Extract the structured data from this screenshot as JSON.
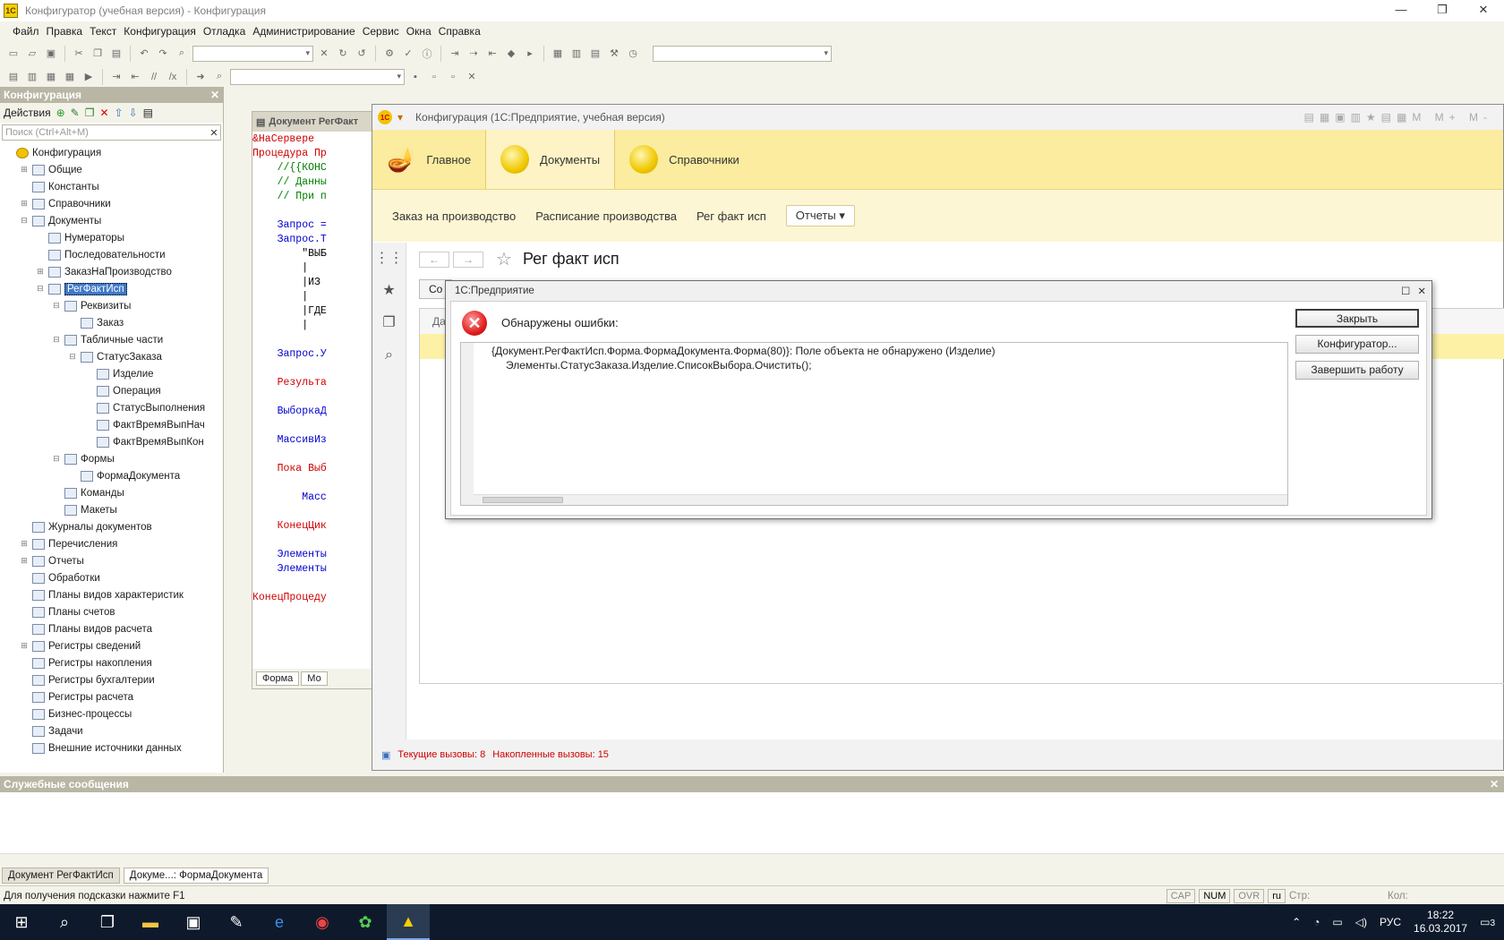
{
  "window": {
    "title": "Конфигуратор (учебная версия) - Конфигурация",
    "controls": [
      "—",
      "❐",
      "✕"
    ]
  },
  "menu": [
    "Файл",
    "Правка",
    "Текст",
    "Конфигурация",
    "Отладка",
    "Администрирование",
    "Сервис",
    "Окна",
    "Справка"
  ],
  "config_panel": {
    "title": "Конфигурация",
    "actions_label": "Действия",
    "search_placeholder": "Поиск (Ctrl+Alt+M)",
    "tree": [
      {
        "label": "Конфигурация",
        "level": 0,
        "exp": "",
        "icon": "config-icon"
      },
      {
        "label": "Общие",
        "level": 1,
        "exp": "⊞",
        "icon": "common-icon"
      },
      {
        "label": "Константы",
        "level": 1,
        "exp": "",
        "icon": "constants-icon"
      },
      {
        "label": "Справочники",
        "level": 1,
        "exp": "⊞",
        "icon": "catalogs-icon"
      },
      {
        "label": "Документы",
        "level": 1,
        "exp": "⊟",
        "icon": "documents-icon"
      },
      {
        "label": "Нумераторы",
        "level": 2,
        "exp": "",
        "icon": "numerators-icon"
      },
      {
        "label": "Последовательности",
        "level": 2,
        "exp": "",
        "icon": "sequences-icon"
      },
      {
        "label": "ЗаказНаПроизводство",
        "level": 2,
        "exp": "⊞",
        "icon": "document-icon"
      },
      {
        "label": "РегФактИсп",
        "level": 2,
        "exp": "⊟",
        "icon": "document-icon",
        "selected": true
      },
      {
        "label": "Реквизиты",
        "level": 3,
        "exp": "⊟",
        "icon": "attributes-icon"
      },
      {
        "label": "Заказ",
        "level": 4,
        "exp": "",
        "icon": "attribute-icon"
      },
      {
        "label": "Табличные части",
        "level": 3,
        "exp": "⊟",
        "icon": "tabular-icon"
      },
      {
        "label": "СтатусЗаказа",
        "level": 4,
        "exp": "⊟",
        "icon": "tabular-icon"
      },
      {
        "label": "Изделие",
        "level": 5,
        "exp": "",
        "icon": "attribute-icon"
      },
      {
        "label": "Операция",
        "level": 5,
        "exp": "",
        "icon": "attribute-icon"
      },
      {
        "label": "СтатусВыполнения",
        "level": 5,
        "exp": "",
        "icon": "attribute-icon"
      },
      {
        "label": "ФактВремяВыпНач",
        "level": 5,
        "exp": "",
        "icon": "attribute-icon"
      },
      {
        "label": "ФактВремяВыпКон",
        "level": 5,
        "exp": "",
        "icon": "attribute-icon"
      },
      {
        "label": "Формы",
        "level": 3,
        "exp": "⊟",
        "icon": "forms-icon"
      },
      {
        "label": "ФормаДокумента",
        "level": 4,
        "exp": "",
        "icon": "form-icon"
      },
      {
        "label": "Команды",
        "level": 3,
        "exp": "",
        "icon": "commands-icon"
      },
      {
        "label": "Макеты",
        "level": 3,
        "exp": "",
        "icon": "templates-icon"
      },
      {
        "label": "Журналы документов",
        "level": 1,
        "exp": "",
        "icon": "journals-icon"
      },
      {
        "label": "Перечисления",
        "level": 1,
        "exp": "⊞",
        "icon": "enums-icon"
      },
      {
        "label": "Отчеты",
        "level": 1,
        "exp": "⊞",
        "icon": "reports-icon"
      },
      {
        "label": "Обработки",
        "level": 1,
        "exp": "",
        "icon": "processing-icon"
      },
      {
        "label": "Планы видов характеристик",
        "level": 1,
        "exp": "",
        "icon": "chart-char-icon"
      },
      {
        "label": "Планы счетов",
        "level": 1,
        "exp": "",
        "icon": "chart-acc-icon"
      },
      {
        "label": "Планы видов расчета",
        "level": 1,
        "exp": "",
        "icon": "chart-calc-icon"
      },
      {
        "label": "Регистры сведений",
        "level": 1,
        "exp": "⊞",
        "icon": "info-reg-icon"
      },
      {
        "label": "Регистры накопления",
        "level": 1,
        "exp": "",
        "icon": "accum-reg-icon"
      },
      {
        "label": "Регистры бухгалтерии",
        "level": 1,
        "exp": "",
        "icon": "acc-reg-icon"
      },
      {
        "label": "Регистры расчета",
        "level": 1,
        "exp": "",
        "icon": "calc-reg-icon"
      },
      {
        "label": "Бизнес-процессы",
        "level": 1,
        "exp": "",
        "icon": "bp-icon"
      },
      {
        "label": "Задачи",
        "level": 1,
        "exp": "",
        "icon": "tasks-icon"
      },
      {
        "label": "Внешние источники данных",
        "level": 1,
        "exp": "",
        "icon": "ext-src-icon"
      }
    ]
  },
  "code_window": {
    "title": "Документ РегФакт",
    "lines": [
      {
        "t": "&НаСервере",
        "c": "cr"
      },
      {
        "t": "Процедура Пр",
        "c": "cr"
      },
      {
        "t": "    //{{КОНС",
        "c": "cg"
      },
      {
        "t": "    // Данны",
        "c": "cg"
      },
      {
        "t": "    // При п",
        "c": "cg"
      },
      {
        "t": "",
        "c": "ck"
      },
      {
        "t": "    Запрос =",
        "c": "cb"
      },
      {
        "t": "    Запрос.Т",
        "c": "cb"
      },
      {
        "t": "        \"ВЫБ",
        "c": "ck"
      },
      {
        "t": "        |",
        "c": "ck"
      },
      {
        "t": "        |ИЗ",
        "c": "ck"
      },
      {
        "t": "        |",
        "c": "ck"
      },
      {
        "t": "        |ГДЕ",
        "c": "ck"
      },
      {
        "t": "        |",
        "c": "ck"
      },
      {
        "t": "",
        "c": "ck"
      },
      {
        "t": "    Запрос.У",
        "c": "cb"
      },
      {
        "t": "",
        "c": "ck"
      },
      {
        "t": "    Результа",
        "c": "cr"
      },
      {
        "t": "",
        "c": "ck"
      },
      {
        "t": "    ВыборкаД",
        "c": "cb"
      },
      {
        "t": "",
        "c": "ck"
      },
      {
        "t": "    МассивИз",
        "c": "cb"
      },
      {
        "t": "",
        "c": "ck"
      },
      {
        "t": "    Пока Выб",
        "c": "cr"
      },
      {
        "t": "",
        "c": "ck"
      },
      {
        "t": "        Масс",
        "c": "cb"
      },
      {
        "t": "",
        "c": "ck"
      },
      {
        "t": "    КонецЦик",
        "c": "cr"
      },
      {
        "t": "",
        "c": "ck"
      },
      {
        "t": "    Элементы",
        "c": "cb"
      },
      {
        "t": "    Элементы",
        "c": "cb"
      },
      {
        "t": "",
        "c": "ck"
      },
      {
        "t": "КонецПроцеду",
        "c": "cr"
      }
    ],
    "tabs": [
      "Форма",
      "Мо"
    ]
  },
  "enterprise": {
    "title": "Конфигурация  (1С:Предприятие, учебная версия)",
    "sections": [
      {
        "label": "Главное",
        "active": false
      },
      {
        "label": "Документы",
        "active": true
      },
      {
        "label": "Справочники",
        "active": false
      }
    ],
    "nav": [
      "Заказ на производство",
      "Расписание производства",
      "Рег факт исп"
    ],
    "reports_label": "Отчеты",
    "page_title": "Рег факт исп",
    "create_btn": "Со",
    "date_col": "Да",
    "status": {
      "current": "Текущие вызовы: 8",
      "accumulated": "Накопленные вызовы: 15"
    }
  },
  "error_dialog": {
    "title": "1С:Предприятие",
    "heading": "Обнаружены ошибки:",
    "line1": "{Документ.РегФактИсп.Форма.ФормаДокумента.Форма(80)}: Поле объекта не обнаружено (Изделие)",
    "line2": "Элементы.СтатусЗаказа.Изделие.СписокВыбора.Очистить();",
    "buttons": {
      "close": "Закрыть",
      "configurator": "Конфигуратор...",
      "exit": "Завершить работу"
    }
  },
  "service_messages": {
    "title": "Служебные сообщения"
  },
  "window_tabs": [
    "Документ РегФактИсп",
    "Докуме...: ФормаДокумента"
  ],
  "statusbar": {
    "hint": "Для получения подсказки нажмите F1",
    "indicators": [
      "CAP",
      "NUM",
      "OVR",
      "ru"
    ],
    "row_label": "Стр:",
    "col_label": "Кол:"
  },
  "taskbar": {
    "lang": "РУС",
    "time": "18:22",
    "date": "16.03.2017",
    "notifications": "3"
  }
}
